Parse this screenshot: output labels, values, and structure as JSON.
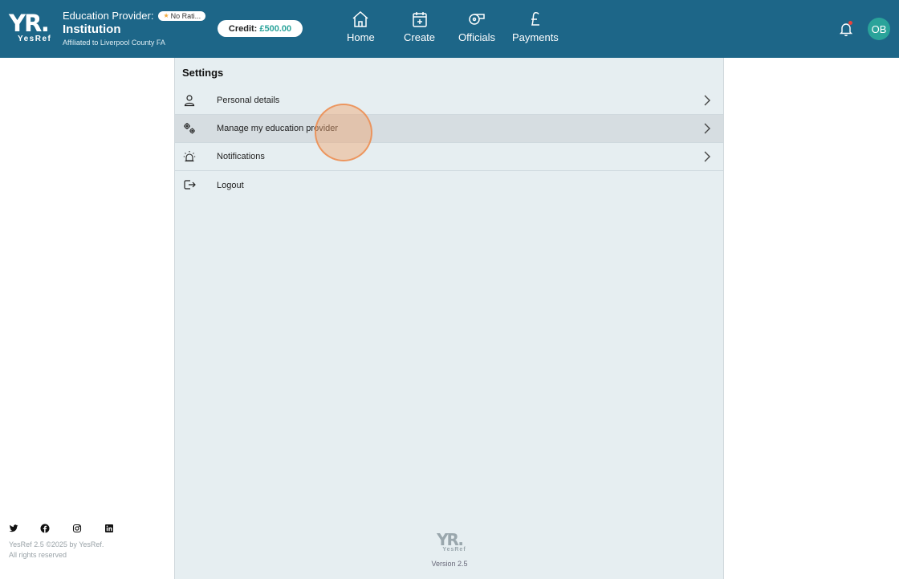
{
  "header": {
    "logo_text": "YR.",
    "logo_sub": "YesRef",
    "provider_label": "Education Provider:",
    "rating_badge": "No Rati...",
    "provider_name": "Institution",
    "affiliation": "Affiliated to Liverpool County FA",
    "credit_label": "Credit:",
    "credit_amount": "£500.00",
    "nav": [
      {
        "label": "Home",
        "icon": "home-icon"
      },
      {
        "label": "Create",
        "icon": "calendar-plus-icon"
      },
      {
        "label": "Officials",
        "icon": "whistle-icon"
      },
      {
        "label": "Payments",
        "icon": "pound-icon"
      }
    ],
    "avatar_initials": "OB",
    "colors": {
      "bar": "#1d6688",
      "accent": "#2aa39a",
      "notification_dot": "#e9433b"
    }
  },
  "settings": {
    "title": "Settings",
    "items": [
      {
        "label": "Personal details",
        "icon": "person-icon",
        "chevron": true
      },
      {
        "label": "Manage my education provider",
        "icon": "gears-icon",
        "chevron": true
      },
      {
        "label": "Notifications",
        "icon": "alarm-icon",
        "chevron": true
      },
      {
        "label": "Logout",
        "icon": "logout-icon",
        "chevron": false
      }
    ]
  },
  "footer": {
    "logo_text": "YR.",
    "logo_sub": "YesRef",
    "version": "Version 2.5",
    "copyright_line1": "YesRef 2.5 ©2025 by YesRef.",
    "copyright_line2": "All rights reserved",
    "social": [
      "twitter-icon",
      "facebook-icon",
      "instagram-icon",
      "linkedin-icon"
    ]
  }
}
